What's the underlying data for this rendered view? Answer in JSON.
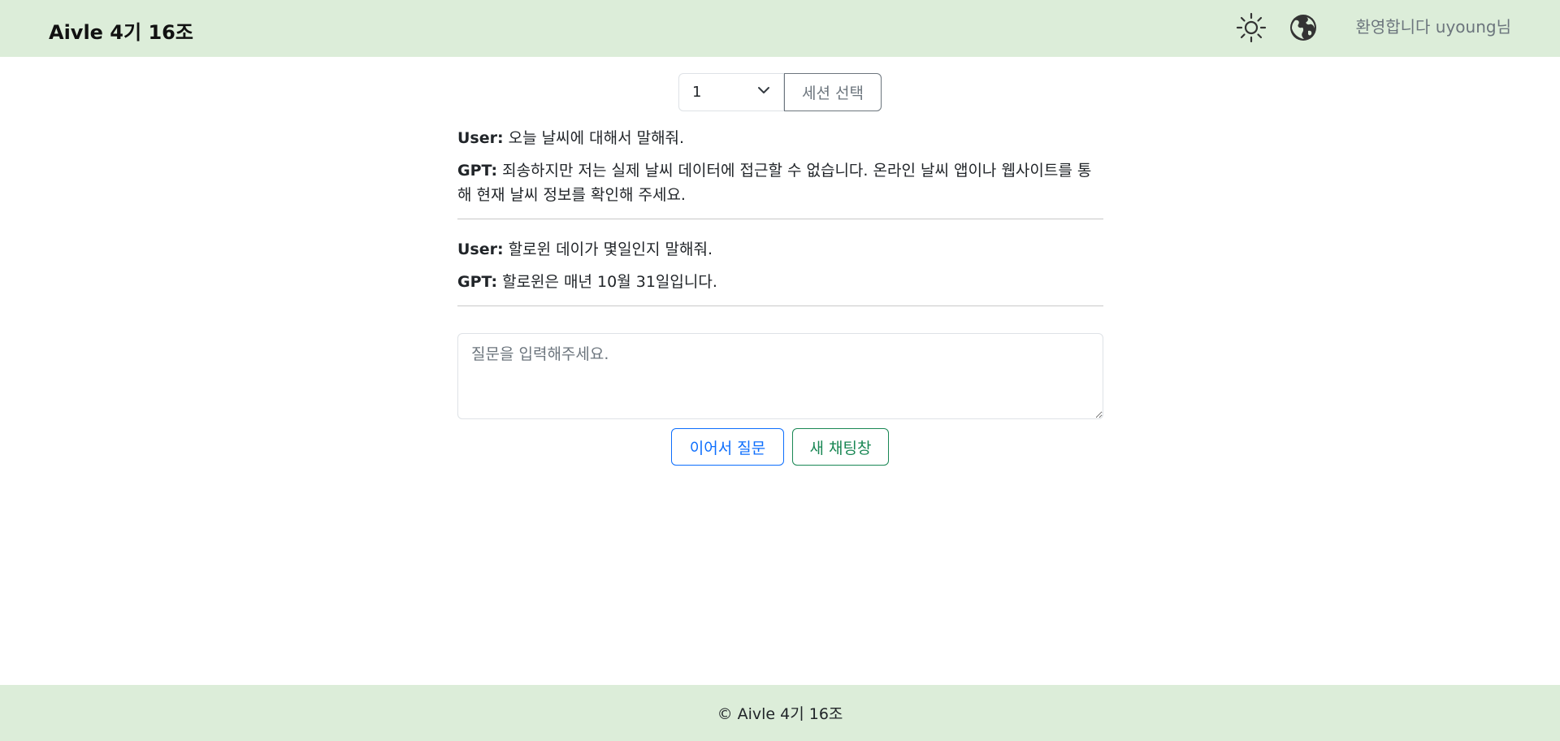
{
  "navbar": {
    "brand": "Aivle 4기 16조",
    "theme_icon": "sun-icon",
    "language_icon": "globe-icon",
    "welcome": "환영합니다 uyoung님"
  },
  "session": {
    "selected": "1",
    "button_label": "세션 선택"
  },
  "chat": {
    "exchanges": [
      {
        "user_label": "User:",
        "user_text": " 오늘 날씨에 대해서 말해줘.",
        "gpt_label": "GPT:",
        "gpt_text": " 죄송하지만 저는 실제 날씨 데이터에 접근할 수 없습니다. 온라인 날씨 앱이나 웹사이트를 통해 현재 날씨 정보를 확인해 주세요."
      },
      {
        "user_label": "User:",
        "user_text": " 할로윈 데이가 몇일인지 말해줘.",
        "gpt_label": "GPT:",
        "gpt_text": " 할로윈은 매년 10월 31일입니다."
      }
    ]
  },
  "input": {
    "placeholder": "질문을 입력해주세요.",
    "value": ""
  },
  "actions": {
    "continue_label": "이어서 질문",
    "new_chat_label": "새 채팅창"
  },
  "footer": {
    "text": "© Aivle 4기 16조"
  },
  "colors": {
    "header_bg": "#dcedd9",
    "primary": "#0d6efd",
    "success": "#198754",
    "secondary": "#6c757d"
  }
}
